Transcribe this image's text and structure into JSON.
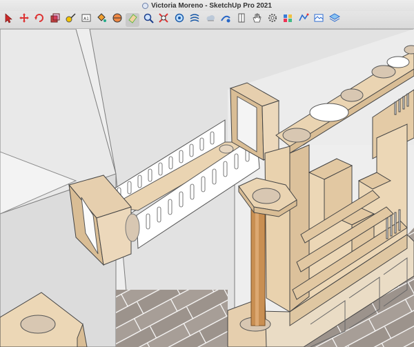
{
  "window": {
    "title": "Victoria Moreno - SketchUp Pro 2021"
  },
  "toolbar": {
    "tools": [
      {
        "name": "select-tool",
        "icon": "arrow-icon"
      },
      {
        "name": "move-tool",
        "icon": "move-icon"
      },
      {
        "name": "rotate-tool",
        "icon": "rotate-icon"
      },
      {
        "name": "scale-tool",
        "icon": "scale-icon"
      },
      {
        "name": "tape-measure-tool",
        "icon": "tape-icon"
      },
      {
        "name": "dimension-tool",
        "icon": "dimension-icon"
      },
      {
        "name": "paint-bucket-tool",
        "icon": "paint-bucket-icon"
      },
      {
        "name": "section-plane-tool",
        "icon": "section-icon"
      },
      {
        "name": "eraser-tool",
        "icon": "eraser-icon"
      },
      {
        "name": "zoom-tool",
        "icon": "zoom-icon"
      },
      {
        "name": "zoom-extents-tool",
        "icon": "zoom-extents-icon"
      },
      {
        "name": "orbit-tool",
        "icon": "orbit-icon"
      },
      {
        "name": "bend-tool",
        "icon": "bend-icon"
      },
      {
        "name": "cloud-tool",
        "icon": "cloud-icon"
      },
      {
        "name": "flip-tool",
        "icon": "flip-icon"
      },
      {
        "name": "door-tool",
        "icon": "door-icon"
      },
      {
        "name": "pan-tool",
        "icon": "hand-icon"
      },
      {
        "name": "settings-tool",
        "icon": "gear-icon"
      },
      {
        "name": "components-tool",
        "icon": "components-icon"
      },
      {
        "name": "styles-tool",
        "icon": "styles-icon"
      },
      {
        "name": "scenes-tool",
        "icon": "scenes-icon"
      },
      {
        "name": "layers-tool",
        "icon": "layers-icon"
      }
    ],
    "active_index": 8
  }
}
